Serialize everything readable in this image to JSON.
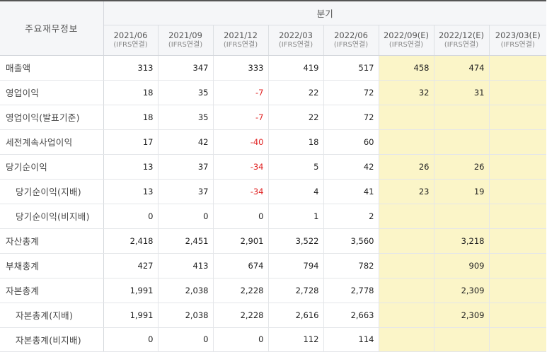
{
  "table": {
    "corner_label": "주요재무정보",
    "group_label": "분기",
    "periods": [
      {
        "period": "2021/06",
        "basis": "(IFRS연결)",
        "estimate": false
      },
      {
        "period": "2021/09",
        "basis": "(IFRS연결)",
        "estimate": false
      },
      {
        "period": "2021/12",
        "basis": "(IFRS연결)",
        "estimate": false
      },
      {
        "period": "2022/03",
        "basis": "(IFRS연결)",
        "estimate": false
      },
      {
        "period": "2022/06",
        "basis": "(IFRS연결)",
        "estimate": false
      },
      {
        "period": "2022/09(E)",
        "basis": "(IFRS연결)",
        "estimate": true
      },
      {
        "period": "2022/12(E)",
        "basis": "(IFRS연결)",
        "estimate": true
      },
      {
        "period": "2023/03(E)",
        "basis": "(IFRS연결)",
        "estimate": true
      }
    ],
    "rows": [
      {
        "label": "매출액",
        "sub": false,
        "values": [
          "313",
          "347",
          "333",
          "419",
          "517",
          "458",
          "474",
          ""
        ]
      },
      {
        "label": "영업이익",
        "sub": false,
        "values": [
          "18",
          "35",
          "-7",
          "22",
          "72",
          "32",
          "31",
          ""
        ]
      },
      {
        "label": "영업이익(발표기준)",
        "sub": false,
        "values": [
          "18",
          "35",
          "-7",
          "22",
          "72",
          "",
          "",
          ""
        ]
      },
      {
        "label": "세전계속사업이익",
        "sub": false,
        "values": [
          "17",
          "42",
          "-40",
          "18",
          "60",
          "",
          "",
          ""
        ]
      },
      {
        "label": "당기순이익",
        "sub": false,
        "values": [
          "13",
          "37",
          "-34",
          "5",
          "42",
          "26",
          "26",
          ""
        ]
      },
      {
        "label": "당기순이익(지배)",
        "sub": true,
        "values": [
          "13",
          "37",
          "-34",
          "4",
          "41",
          "23",
          "19",
          ""
        ]
      },
      {
        "label": "당기순이익(비지배)",
        "sub": true,
        "values": [
          "0",
          "0",
          "0",
          "1",
          "2",
          "",
          "",
          ""
        ]
      },
      {
        "label": "자산총계",
        "sub": false,
        "values": [
          "2,418",
          "2,451",
          "2,901",
          "3,522",
          "3,560",
          "",
          "3,218",
          ""
        ]
      },
      {
        "label": "부채총계",
        "sub": false,
        "values": [
          "427",
          "413",
          "674",
          "794",
          "782",
          "",
          "909",
          ""
        ]
      },
      {
        "label": "자본총계",
        "sub": false,
        "values": [
          "1,991",
          "2,038",
          "2,228",
          "2,728",
          "2,778",
          "",
          "2,309",
          ""
        ]
      },
      {
        "label": "자본총계(지배)",
        "sub": true,
        "values": [
          "1,991",
          "2,038",
          "2,228",
          "2,616",
          "2,663",
          "",
          "2,309",
          ""
        ]
      },
      {
        "label": "자본총계(비지배)",
        "sub": true,
        "values": [
          "0",
          "0",
          "0",
          "112",
          "114",
          "",
          "",
          ""
        ]
      }
    ],
    "colors": {
      "negative": "#e02020",
      "estimate_bg": "#fbf5c8",
      "header_bg": "#f5f6f8"
    }
  }
}
